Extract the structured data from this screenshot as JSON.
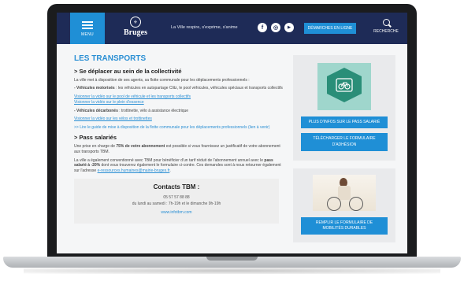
{
  "header": {
    "menu_label": "MENU",
    "logo_name": "Bruges",
    "tagline": "La Ville respire, s'exprime, s'anime",
    "social": [
      {
        "icon": "facebook-icon",
        "glyph": "f"
      },
      {
        "icon": "instagram-icon",
        "glyph": "◎"
      },
      {
        "icon": "youtube-icon",
        "glyph": "▶"
      }
    ],
    "demarches_label": "DÉMARCHES EN LIGNE",
    "search_label": "RECHERCHE"
  },
  "main": {
    "title": "LES TRANSPORTS",
    "section1_heading": "> Se déplacer au sein de la collectivité",
    "section1_intro": "La ville met à disposition de ses agents, sa flotte communale pour les déplacements professionnels :",
    "motorized_label": "- Véhicules motorisés",
    "motorized_text": " : les véhicules en autopartage Clitz, le pool véhicules, véhicules spéciaux et transports collectifs",
    "link_pool": "Visionner la vidéo sur le pool de véhicule et les transports collectifs",
    "link_fuel": "Visionner la vidéo sur le plein d'essence",
    "decarb_label": "- Véhicules décarbonés",
    "decarb_text": " : trottinette, vélo à assistance électrique",
    "link_bikes": "Visionner la vidéo sur les vélos et trottinettes",
    "link_guide": ">> Lire le guide de mise à disposition de la flotte communale pour les déplacements professionnels (lien à venir)",
    "section2_heading": "> Pass salariés",
    "pass_p1_a": "Une prise en charge de ",
    "pass_p1_bold": "75% de votre abonnement",
    "pass_p1_b": " est possible si vous fournissez un justificatif de votre abonnement aux transports TBM.",
    "pass_p2_a": "La ville a également conventionné avec TBM pour bénéficier d'un tarif réduit de l'abonnement annuel avec le ",
    "pass_p2_bold": "pass salarié à -20%",
    "pass_p2_b": " dont vous trouverez également le formulaire ci-contre. Ces demandes sont à nous retourner également sur l'adresse ",
    "pass_email": "e-ressources.humaines@mairie-bruges.fr",
    "pass_p2_end": "."
  },
  "contacts": {
    "title": "Contacts TBM :",
    "phone": "05 57 57 88 88",
    "hours": "du lundi au samedi : 7h-19h et le dimanche 9h-19h",
    "url": "www.infotbm.com"
  },
  "sidebar": {
    "btn_info": "PLUS D'INFOS SUR LE PASS SALARIÉ",
    "btn_form": "TÉLÉCHARGER LE FORMULAIRE D'ADHÉSION",
    "btn_mobility": "REMPLIR LE FORMULAIRE DE MOBILITÉS DURABLES"
  },
  "colors": {
    "header_bg": "#1e2b57",
    "accent_blue": "#1f8fd6",
    "title_blue": "#2a8fd4",
    "panel_grey": "#e9eaec",
    "teal": "#2a8e78"
  }
}
